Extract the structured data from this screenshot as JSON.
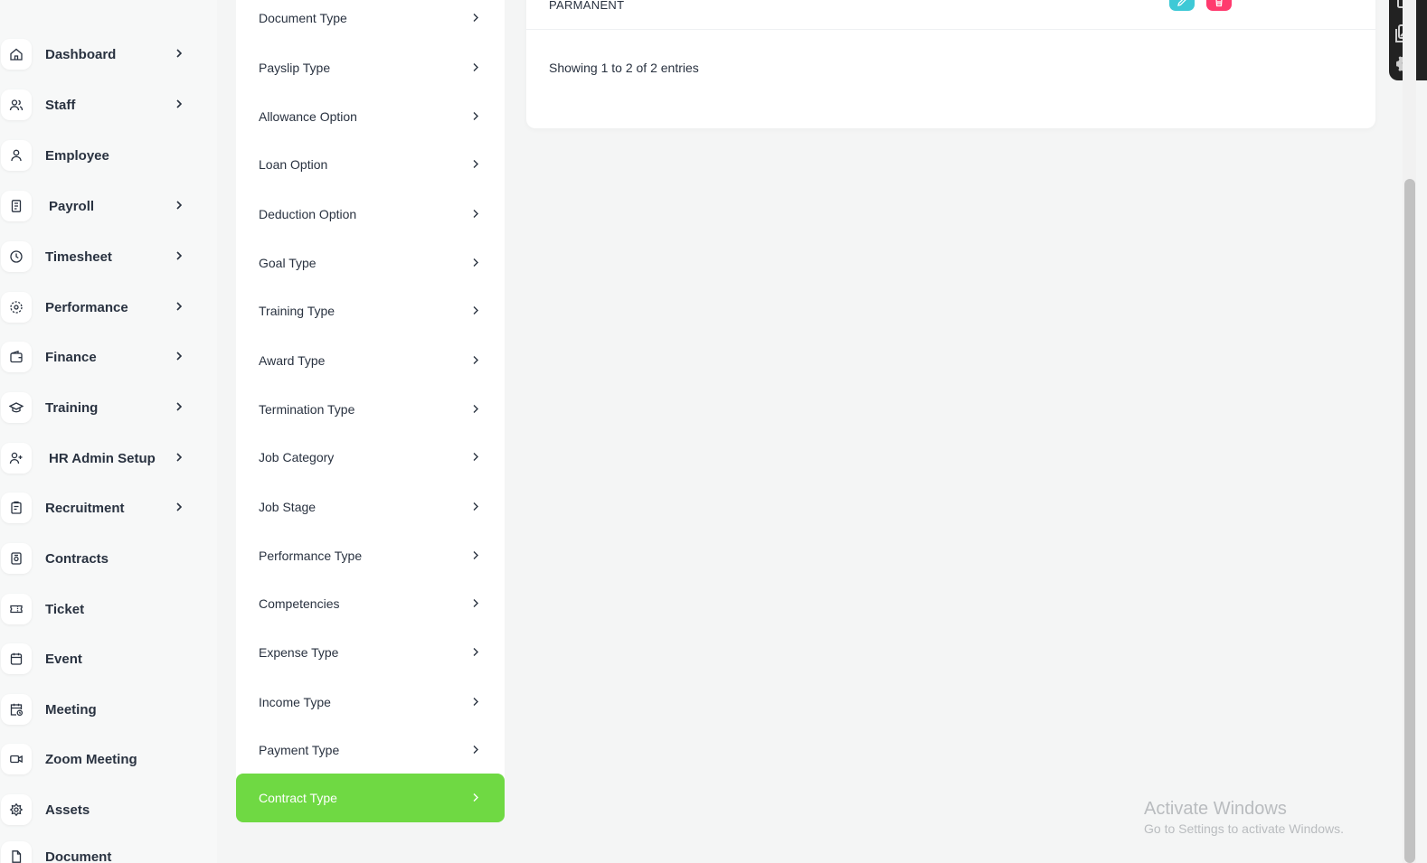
{
  "sidebar": {
    "items": [
      {
        "label": "Dashboard",
        "icon": "home-icon",
        "has_chevron": true
      },
      {
        "label": "Staff",
        "icon": "users-icon",
        "has_chevron": true
      },
      {
        "label": "Employee",
        "icon": "user-icon",
        "has_chevron": false
      },
      {
        "label": "Payroll",
        "icon": "receipt-icon",
        "has_chevron": true
      },
      {
        "label": "Timesheet",
        "icon": "clock-icon",
        "has_chevron": true
      },
      {
        "label": "Performance",
        "icon": "target-icon",
        "has_chevron": true
      },
      {
        "label": "Finance",
        "icon": "wallet-icon",
        "has_chevron": true
      },
      {
        "label": "Training",
        "icon": "graduation-cap-icon",
        "has_chevron": true
      },
      {
        "label": "HR Admin Setup",
        "icon": "user-plus-icon",
        "has_chevron": true
      },
      {
        "label": "Recruitment",
        "icon": "clipboard-icon",
        "has_chevron": true
      },
      {
        "label": "Contracts",
        "icon": "file-contract-icon",
        "has_chevron": false
      },
      {
        "label": "Ticket",
        "icon": "ticket-icon",
        "has_chevron": false
      },
      {
        "label": "Event",
        "icon": "calendar-icon",
        "has_chevron": false
      },
      {
        "label": "Meeting",
        "icon": "calendar-clock-icon",
        "has_chevron": false
      },
      {
        "label": "Zoom Meeting",
        "icon": "video-icon",
        "has_chevron": false
      },
      {
        "label": "Assets",
        "icon": "asset-icon",
        "has_chevron": false
      },
      {
        "label": "Document",
        "icon": "document-icon",
        "has_chevron": false
      }
    ]
  },
  "submenu": {
    "items": [
      {
        "label": "Document Type",
        "active": false
      },
      {
        "label": "Payslip Type",
        "active": false
      },
      {
        "label": "Allowance Option",
        "active": false
      },
      {
        "label": "Loan Option",
        "active": false
      },
      {
        "label": "Deduction Option",
        "active": false
      },
      {
        "label": "Goal Type",
        "active": false
      },
      {
        "label": "Training Type",
        "active": false
      },
      {
        "label": "Award Type",
        "active": false
      },
      {
        "label": "Termination Type",
        "active": false
      },
      {
        "label": "Job Category",
        "active": false
      },
      {
        "label": "Job Stage",
        "active": false
      },
      {
        "label": "Performance Type",
        "active": false
      },
      {
        "label": "Competencies",
        "active": false
      },
      {
        "label": "Expense Type",
        "active": false
      },
      {
        "label": "Income Type",
        "active": false
      },
      {
        "label": "Payment Type",
        "active": false
      },
      {
        "label": "Contract Type",
        "active": true
      }
    ]
  },
  "content": {
    "row_value": "PARMANENT",
    "edit_icon": "pencil-icon",
    "delete_icon": "trash-icon",
    "entries_text": "Showing 1 to 2 of 2 entries"
  },
  "float_toolbar": {
    "icons": [
      "book-icon",
      "images-icon",
      "gear-icon"
    ]
  },
  "watermark": {
    "title": "Activate Windows",
    "subtitle": "Go to Settings to activate Windows."
  },
  "colors": {
    "accent": "#6fd943",
    "edit_button": "#3ec9d6",
    "delete_button": "#ff3a6e",
    "text": "#293240",
    "page_bg": "#f4f5f5"
  }
}
